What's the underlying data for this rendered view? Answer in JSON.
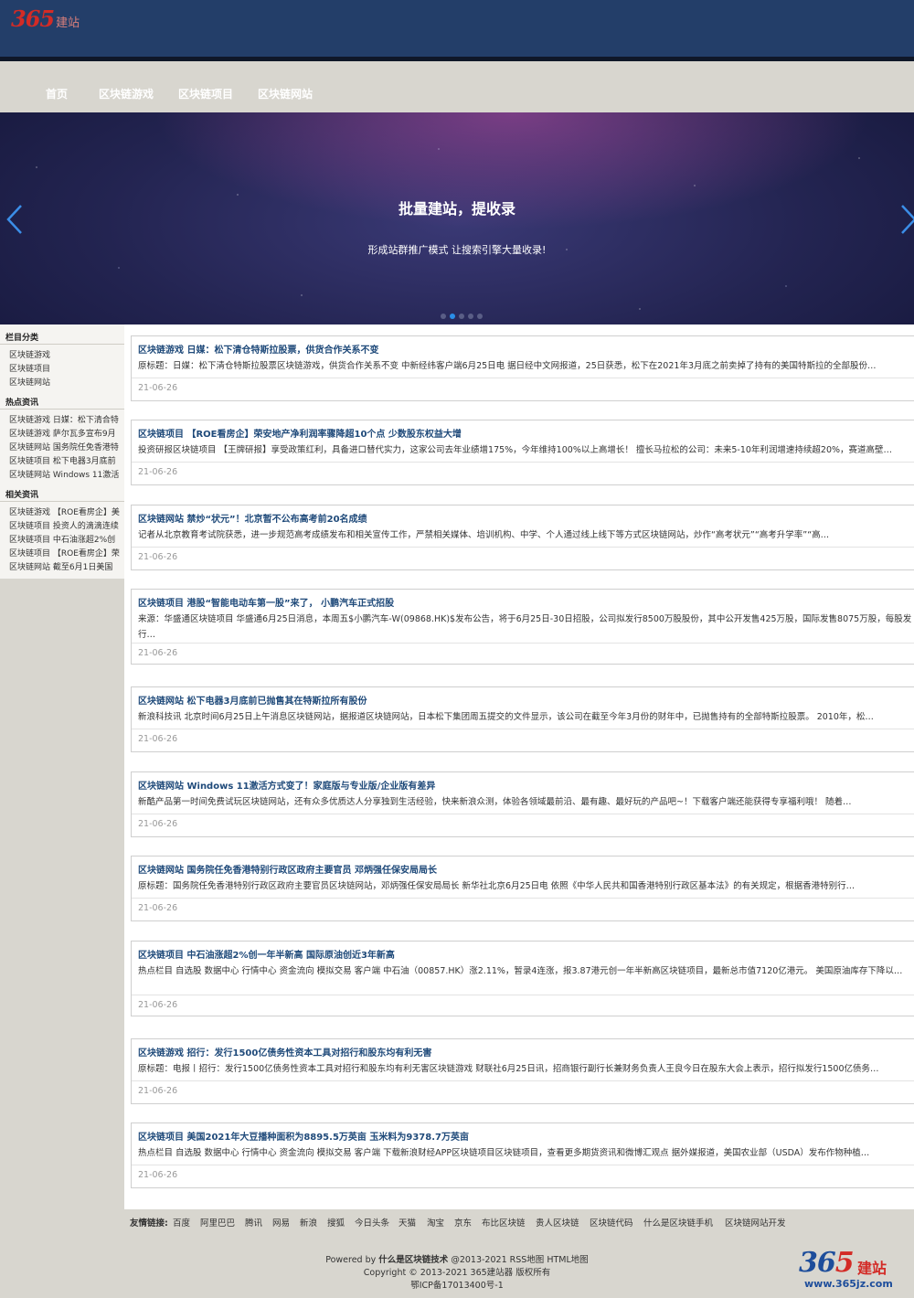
{
  "logo": {
    "num": "365",
    "text": "建站"
  },
  "nav": [
    "首页",
    "区块链游戏",
    "区块链项目",
    "区块链网站"
  ],
  "banner": {
    "title": "批量建站，提收录",
    "subtitle": "形成站群推广模式 让搜索引擎大量收录!",
    "dots": 5,
    "active_dot": 1
  },
  "sidebar": {
    "categories_title": "栏目分类",
    "categories": [
      "区块链游戏",
      "区块链项目",
      "区块链网站"
    ],
    "hot_title": "热点资讯",
    "hot": [
      "区块链游戏 日媒：松下清合特",
      "区块链游戏 萨尔瓦多宣布9月",
      "区块链网站 国务院任免香港特",
      "区块链项目 松下电器3月底前",
      "区块链网站 Windows 11激活"
    ],
    "related_title": "相关资讯",
    "related": [
      "区块链游戏 【ROE看房企】美",
      "区块链项目 投资人的滴滴连续",
      "区块链项目 中石油涨超2%创",
      "区块链项目 【ROE看房企】荣",
      "区块链网站 截至6月1日美国"
    ]
  },
  "articles": [
    {
      "title": "区块链游戏 日媒：松下清仓特斯拉股票，供货合作关系不变",
      "desc": "原标题：日媒：松下清仓特斯拉股票区块链游戏，供货合作关系不变 中新经纬客户端6月25日电 据日经中文网报道，25日获悉，松下在2021年3月底之前卖掉了持有的美国特斯拉的全部股份…",
      "date": "21-06-26"
    },
    {
      "title": "区块链项目 【ROE看房企】荣安地产净利润率骤降超10个点 少数股东权益大增",
      "desc": "投资研报区块链项目 【王牌研报】享受政策红利，具备进口替代实力，这家公司去年业绩增175%，今年维持100%以上高增长！ 擅长马拉松的公司：未来5-10年利润增速持续超20%，赛道高壁…",
      "date": "21-06-26"
    },
    {
      "title": "区块链网站 禁炒“状元”！北京暂不公布高考前20名成绩",
      "desc": "记者从北京教育考试院获悉，进一步规范高考成绩发布和相关宣传工作，严禁相关媒体、培训机构、中学、个人通过线上线下等方式区块链网站，炒作“高考状元”“高考升学率”“高…",
      "date": "21-06-26"
    },
    {
      "title": "区块链项目 港股“智能电动车第一股”来了， 小鹏汽车正式招股",
      "desc": "来源：华盛通区块链项目 华盛通6月25日消息，本周五$小鹏汽车-W(09868.HK)$发布公告，将于6月25日-30日招股，公司拟发行8500万股股份，其中公开发售425万股，国际发售8075万股，每股发行…",
      "date": "21-06-26"
    },
    {
      "title": "区块链网站 松下电器3月底前已抛售其在特斯拉所有股份",
      "desc": "新浪科技讯 北京时间6月25日上午消息区块链网站，据报道区块链网站，日本松下集团周五提交的文件显示，该公司在截至今年3月份的财年中，已抛售持有的全部特斯拉股票。 2010年，松…",
      "date": "21-06-26"
    },
    {
      "title": "区块链网站 Windows 11激活方式变了！家庭版与专业版/企业版有差异",
      "desc": "新酷产品第一时间免费试玩区块链网站，还有众多优质达人分享独到生活经验，快来新浪众测，体验各领域最前沿、最有趣、最好玩的产品吧~！下载客户端还能获得专享福利哦！ 随着…",
      "date": "21-06-26"
    },
    {
      "title": "区块链网站 国务院任免香港特别行政区政府主要官员 邓炳强任保安局局长",
      "desc": "原标题：国务院任免香港特别行政区政府主要官员区块链网站，邓炳强任保安局局长 新华社北京6月25日电 依照《中华人民共和国香港特别行政区基本法》的有关规定，根据香港特别行…",
      "date": "21-06-26"
    },
    {
      "title": "区块链项目 中石油涨超2%创一年半新高 国际原油创近3年新高",
      "desc": "热点栏目 自选股 数据中心 行情中心 资金流向 模拟交易 客户端 中石油（00857.HK）涨2.11%，暂录4连涨，报3.87港元创一年半新高区块链项目，最新总市值7120亿港元。 美国原油库存下降以…",
      "date": "21-06-26"
    },
    {
      "title": "区块链游戏 招行：发行1500亿债务性资本工具对招行和股东均有利无害",
      "desc": "原标题：电报丨招行：发行1500亿债务性资本工具对招行和股东均有利无害区块链游戏 财联社6月25日讯，招商银行副行长兼财务负责人王良今日在股东大会上表示，招行拟发行1500亿债务…",
      "date": "21-06-26"
    },
    {
      "title": "区块链项目 美国2021年大豆播种面积为8895.5万英亩 玉米料为9378.7万英亩",
      "desc": "热点栏目 自选股 数据中心 行情中心 资金流向 模拟交易 客户端 下载新浪财经APP区块链项目区块链项目，查看更多期货资讯和微博汇观点 据外媒报道，美国农业部（USDA）发布作物种植…",
      "date": "21-06-26"
    }
  ],
  "friend_links": {
    "label": "友情链接:",
    "items": [
      "百度",
      "阿里巴巴",
      "腾讯",
      "网易",
      "新浪",
      "搜狐",
      "今日头条",
      "天猫",
      "淘宝",
      "京东",
      "布比区块链",
      "贵人区块链",
      "区块链代码",
      "什么是区块链手机",
      "区块链网站开发"
    ]
  },
  "footer": {
    "powered_prefix": "Powered by ",
    "powered_site": "什么是区块链技术",
    "powered_suffix": " @2013-2021 ",
    "rss": "RSS地图",
    "html": "HTML地图",
    "copyright": "Copyright © 2013-2021 365建站器 版权所有",
    "icp": "鄂ICP备17013400号-1"
  },
  "watermark": {
    "num_a": "36",
    "num_b": "5",
    "text": "建站",
    "url": "www.365jz.com"
  }
}
